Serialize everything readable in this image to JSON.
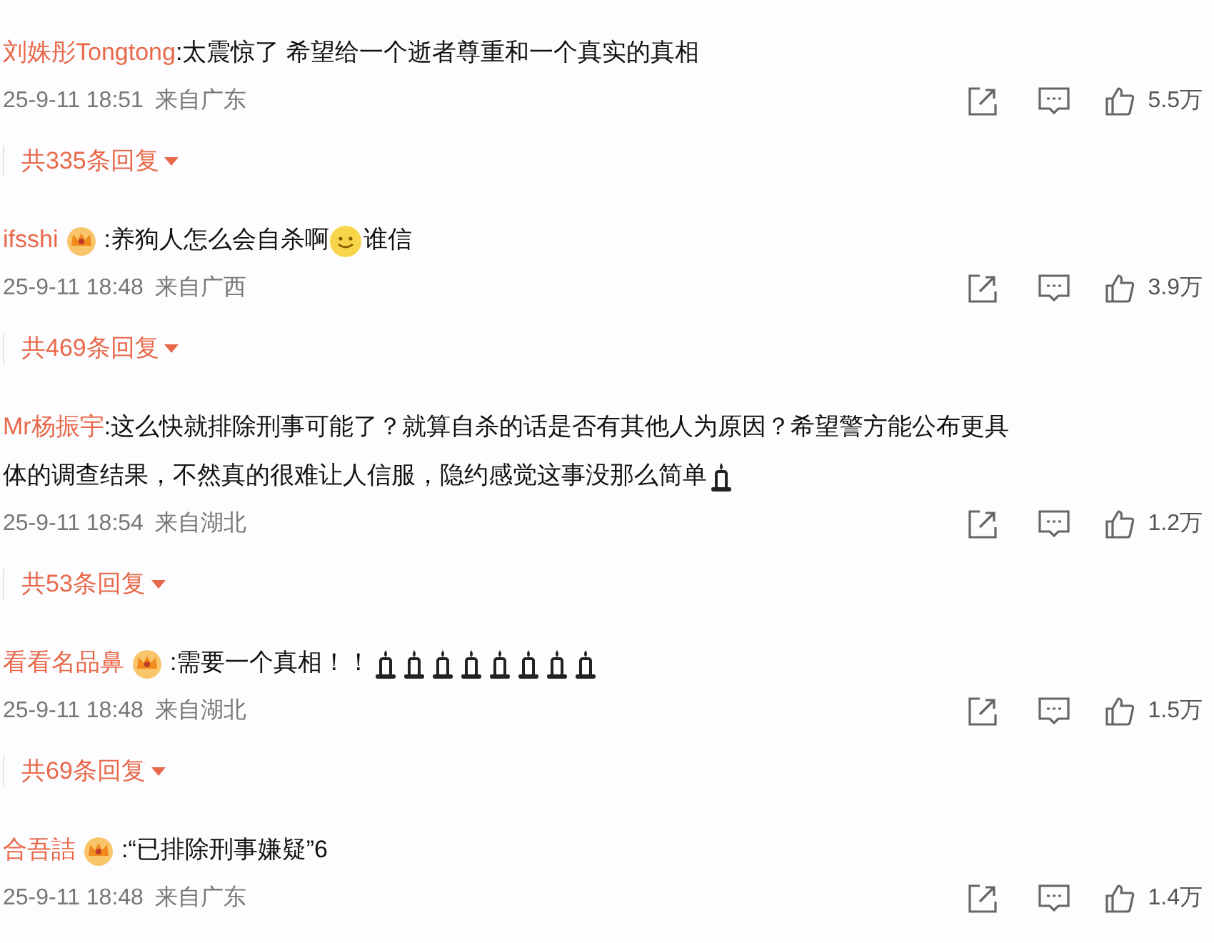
{
  "comments": [
    {
      "user": "刘姝彤Tongtong",
      "badge": false,
      "content": [
        {
          "kind": "text",
          "text": ":太震惊了 希望给一个逝者尊重和一个真实的真相"
        }
      ],
      "time": "25-9-11 18:51",
      "location": "来自广东",
      "likes": "5.5万",
      "replies": "共335条回复"
    },
    {
      "user": "ifsshi",
      "badge": true,
      "content": [
        {
          "kind": "text",
          "text": ":养狗人怎么会自杀啊"
        },
        {
          "kind": "smile"
        },
        {
          "kind": "text",
          "text": "谁信"
        }
      ],
      "time": "25-9-11 18:48",
      "location": "来自广西",
      "likes": "3.9万",
      "replies": "共469条回复"
    },
    {
      "user": "Mr杨振宇",
      "badge": false,
      "content": [
        {
          "kind": "text",
          "text": ":这么快就排除刑事可能了？就算自杀的话是否有其他人为原因？希望警方能公布更具"
        },
        {
          "kind": "text",
          "text": "体的调查结果，不然真的很难让人信服，隐约感觉这事没那么简单"
        },
        {
          "kind": "candle"
        }
      ],
      "time": "25-9-11 18:54",
      "location": "来自湖北",
      "likes": "1.2万",
      "replies": "共53条回复"
    },
    {
      "user": "看看名品鼻",
      "badge": true,
      "content": [
        {
          "kind": "text",
          "text": ":需要一个真相！！"
        },
        {
          "kind": "candle"
        },
        {
          "kind": "candle"
        },
        {
          "kind": "candle"
        },
        {
          "kind": "candle"
        },
        {
          "kind": "candle"
        },
        {
          "kind": "candle"
        },
        {
          "kind": "candle"
        },
        {
          "kind": "candle"
        }
      ],
      "time": "25-9-11 18:48",
      "location": "来自湖北",
      "likes": "1.5万",
      "replies": "共69条回复"
    },
    {
      "user": "合吾詰",
      "badge": true,
      "content": [
        {
          "kind": "text",
          "text": ":“已排除刑事嫌疑”6"
        }
      ],
      "time": "25-9-11 18:48",
      "location": "来自广东",
      "likes": "1.4万"
    }
  ]
}
